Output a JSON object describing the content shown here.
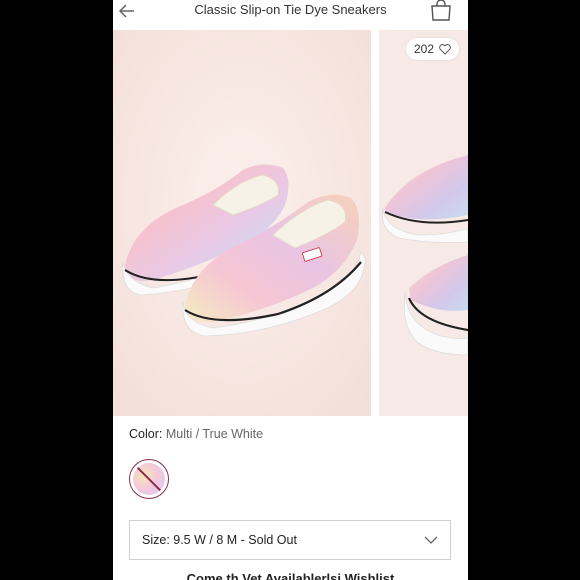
{
  "header": {
    "title": "Classic Slip-on Tie Dye Sneakers",
    "back_icon": "arrow-left-icon",
    "bag_icon": "shopping-bag-icon"
  },
  "gallery": {
    "favorite_count": "202",
    "favorite_icon": "heart-icon"
  },
  "details": {
    "color_label": "Color:",
    "color_value": "Multi / True White",
    "size_value": "Size: 9.5 W / 8 M - Sold Out",
    "bottom_text": "Come th Vet Availablerlsi Wishlist"
  },
  "colors": {
    "accent": "#8a2c4f",
    "header_text": "#333333"
  }
}
